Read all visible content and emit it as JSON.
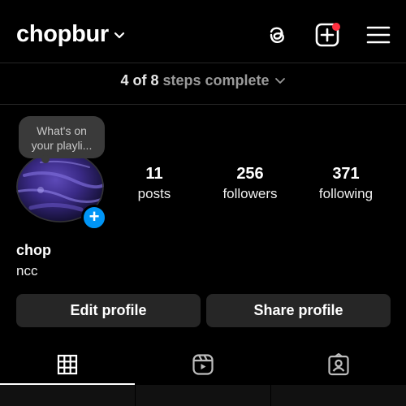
{
  "header": {
    "username": "chopbur",
    "accent_notification_color": "#ff3040"
  },
  "icons": {
    "username_dropdown": "chevron-down-icon",
    "threads": "threads-icon",
    "create": "create-post-icon",
    "menu": "hamburger-menu-icon",
    "grid_tab": "grid-icon",
    "reels_tab": "reels-icon",
    "tagged_tab": "tagged-icon"
  },
  "steps": {
    "done": "4",
    "of": "of",
    "total": "8",
    "rest": "steps complete"
  },
  "note": {
    "line1": "What's on",
    "line2": "your playli..."
  },
  "stats": {
    "posts": {
      "value": "11",
      "label": "posts"
    },
    "followers": {
      "value": "256",
      "label": "followers"
    },
    "following": {
      "value": "371",
      "label": "following"
    }
  },
  "profile": {
    "name": "chop",
    "bio": "ncc"
  },
  "buttons": {
    "edit": "Edit profile",
    "share": "Share profile"
  },
  "colors": {
    "background": "#000000",
    "button_bg": "#262626",
    "add_story_blue": "#0095f6"
  }
}
